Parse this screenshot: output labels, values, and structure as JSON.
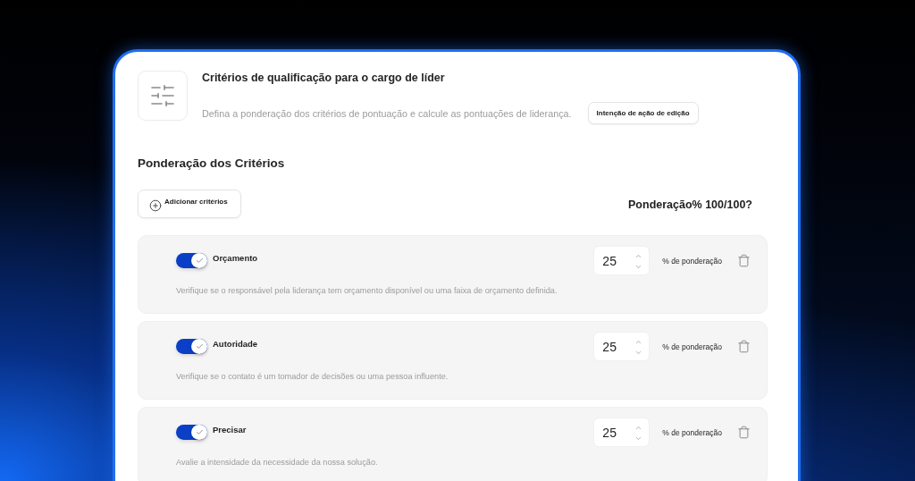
{
  "header": {
    "title": "Critérios de qualificação para o cargo de líder",
    "description": "Defina a ponderação dos critérios de pontuação e calcule as pontuações de liderança.",
    "edit_button": "Intenção de ação de edição"
  },
  "section": {
    "title": "Ponderação dos Critérios",
    "add_button": "Adicionar critérios",
    "total": "Ponderação% 100/100?"
  },
  "criteria": [
    {
      "name": "Orçamento",
      "on": true,
      "value": "25",
      "unit": "% de ponderação",
      "description": "Verifique se o responsável pela liderança tem orçamento disponível ou uma faixa de orçamento definida."
    },
    {
      "name": "Autoridade",
      "on": true,
      "value": "25",
      "unit": "% de ponderação",
      "description": "Verifique se o contato é um tomador de decisões ou uma pessoa influente."
    },
    {
      "name": "Precisar",
      "on": true,
      "value": "25",
      "unit": "% de ponderação",
      "description": "Avalie a intensidade da necessidade da nossa solução."
    }
  ]
}
